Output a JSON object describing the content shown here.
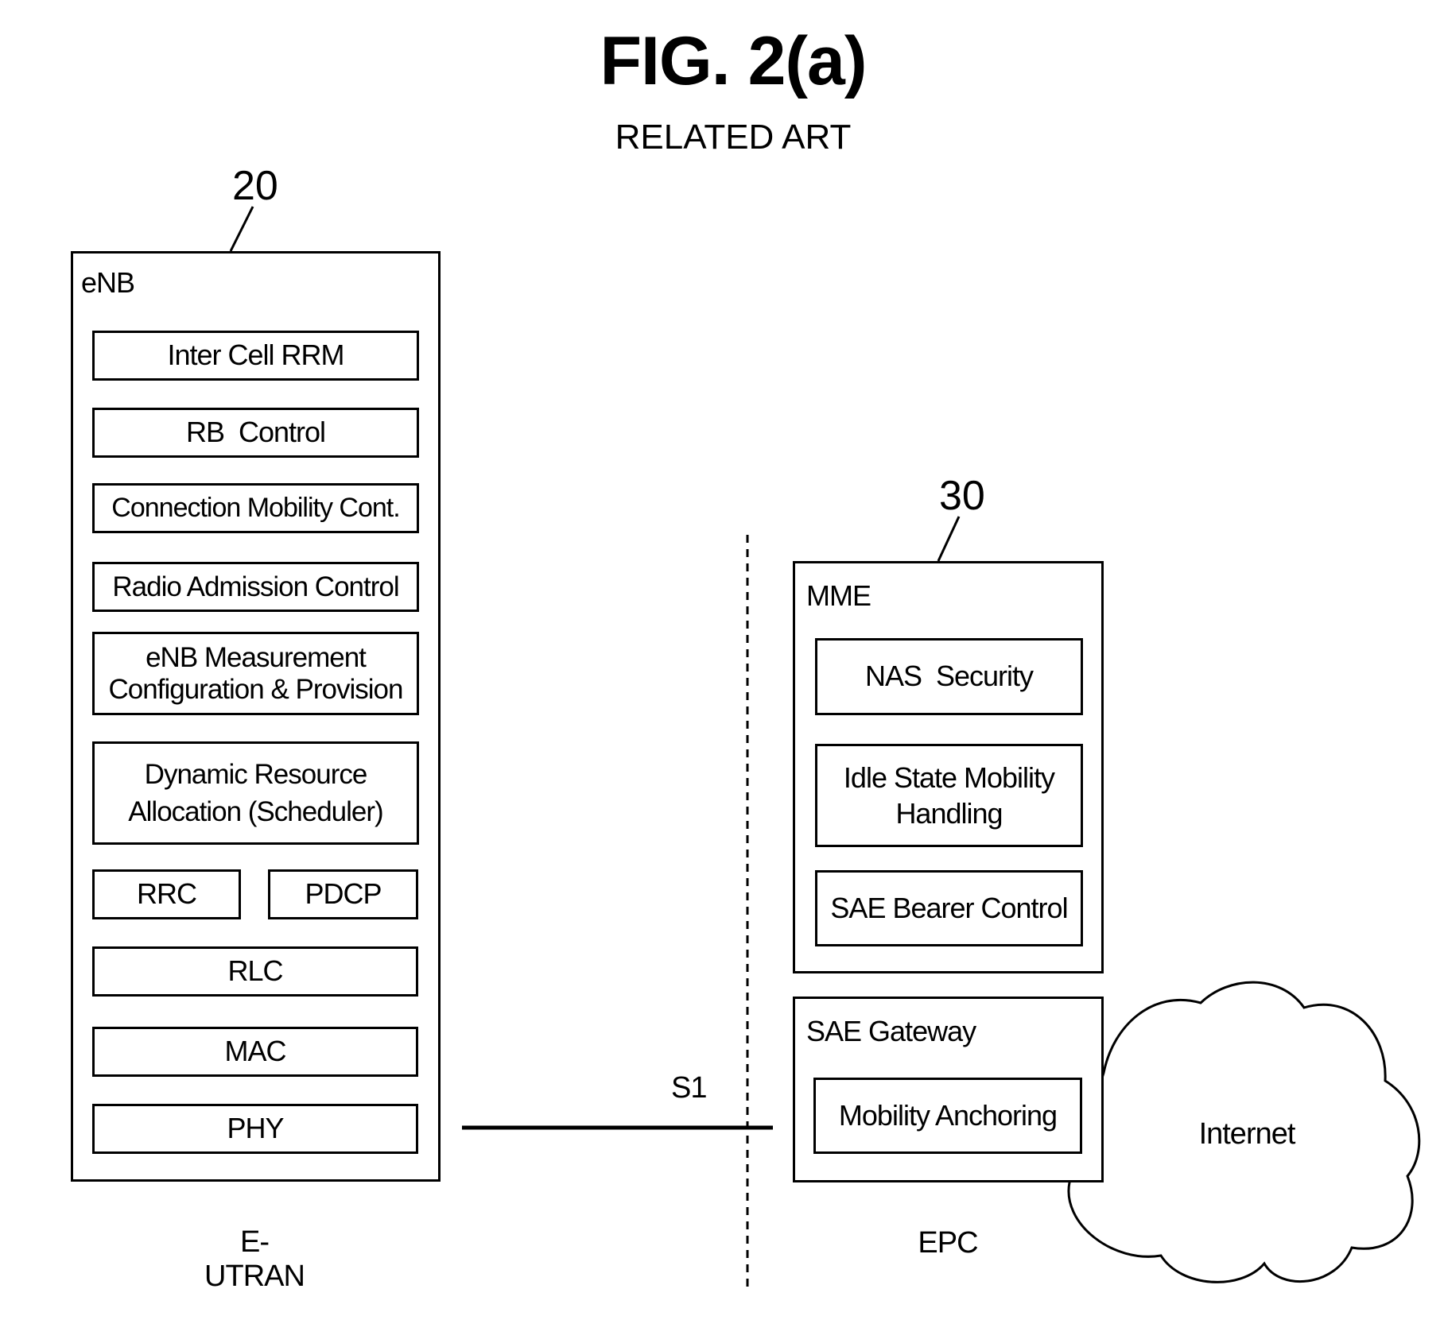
{
  "figure": {
    "title": "FIG. 2(a)",
    "subtitle": "RELATED ART"
  },
  "enb": {
    "ref_number": "20",
    "label": "eNB",
    "functions": [
      "Inter Cell RRM",
      "RB  Control",
      "Connection Mobility Cont.",
      "Radio Admission Control",
      "eNB Measurement\nConfiguration & Provision",
      "Dynamic Resource\nAllocation (Scheduler)"
    ],
    "protocol_stack": {
      "rrc": "RRC",
      "pdcp": "PDCP",
      "rlc": "RLC",
      "mac": "MAC",
      "phy": "PHY"
    },
    "region_label": "E-UTRAN"
  },
  "interface": {
    "label": "S1"
  },
  "epc": {
    "ref_number": "30",
    "mme": {
      "label": "MME",
      "functions": [
        "NAS  Security",
        "Idle State Mobility\nHandling",
        "SAE Bearer Control"
      ]
    },
    "sae_gateway": {
      "label": "SAE Gateway",
      "functions": [
        "Mobility Anchoring"
      ]
    },
    "region_label": "EPC"
  },
  "cloud": {
    "label": "Internet"
  }
}
